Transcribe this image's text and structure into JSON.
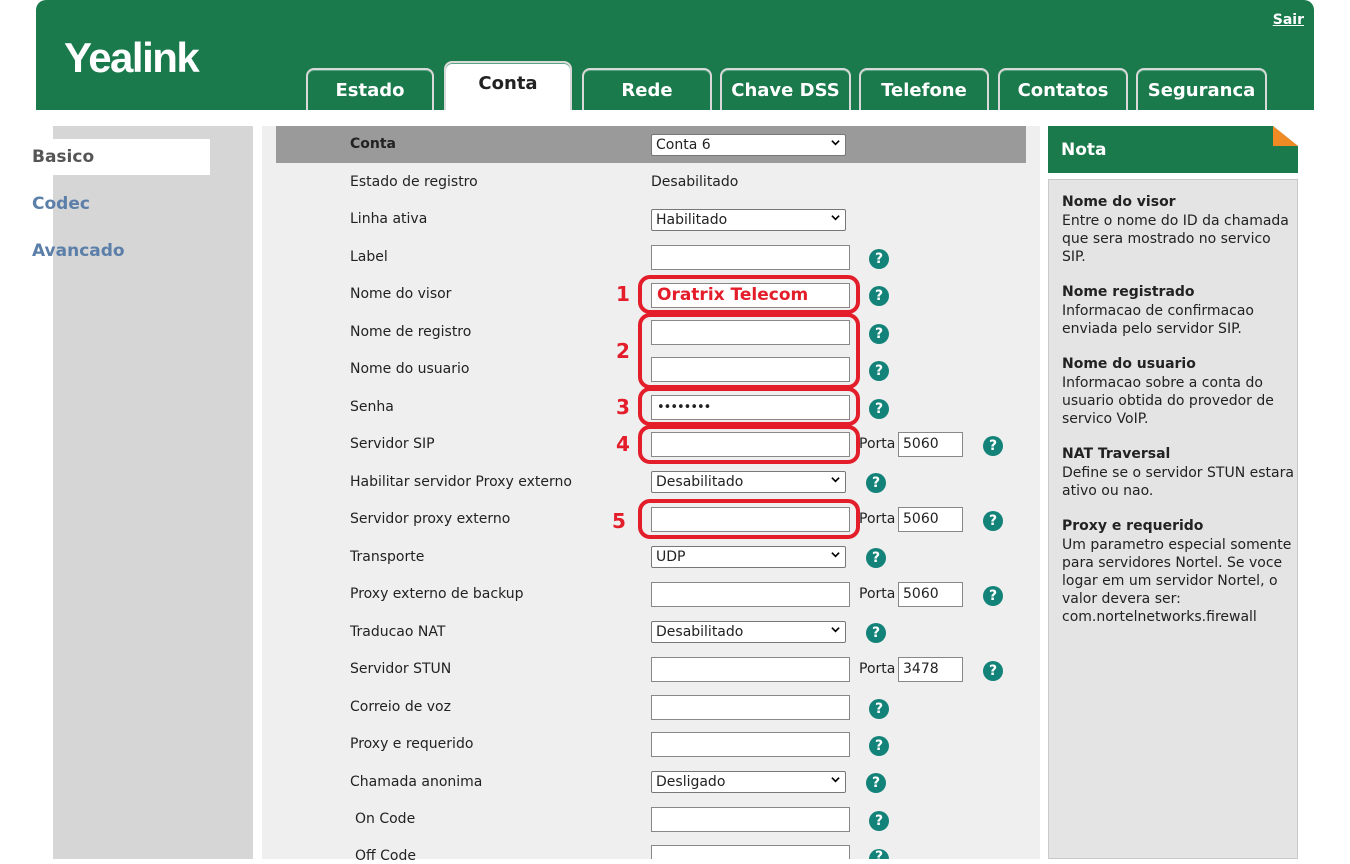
{
  "header": {
    "brand": "Yealink",
    "logout": "Sair",
    "tabs": [
      "Estado",
      "Conta",
      "Rede",
      "Chave DSS",
      "Telefone",
      "Contatos",
      "Seguranca"
    ],
    "active_tab": "Conta"
  },
  "sidebar": {
    "items": [
      "Basico",
      "Codec",
      "Avancado"
    ],
    "active": "Basico"
  },
  "form": {
    "header_label": "Conta",
    "account_select": "Conta 6",
    "porta_label": "Porta",
    "rows": {
      "estado_registro": {
        "label": "Estado de registro",
        "value": "Desabilitado"
      },
      "linha_ativa": {
        "label": "Linha ativa",
        "value": "Habilitado"
      },
      "label": {
        "label": "Label",
        "value": ""
      },
      "nome_visor": {
        "label": "Nome do visor",
        "value": "Oratrix Telecom"
      },
      "nome_registro": {
        "label": "Nome de registro",
        "value": ""
      },
      "nome_usuario": {
        "label": "Nome do usuario",
        "value": ""
      },
      "senha": {
        "label": "Senha",
        "value": "••••••••"
      },
      "servidor_sip": {
        "label": "Servidor SIP",
        "value": "",
        "porta": "5060"
      },
      "habilitar_proxy": {
        "label": "Habilitar servidor Proxy externo",
        "value": "Desabilitado"
      },
      "servidor_proxy": {
        "label": "Servidor proxy externo",
        "value": "",
        "porta": "5060"
      },
      "transporte": {
        "label": "Transporte",
        "value": "UDP"
      },
      "proxy_backup": {
        "label": "Proxy externo de backup",
        "value": "",
        "porta": "5060"
      },
      "traducao_nat": {
        "label": "Traducao NAT",
        "value": "Desabilitado"
      },
      "servidor_stun": {
        "label": "Servidor STUN",
        "value": "",
        "porta": "3478"
      },
      "correio_voz": {
        "label": "Correio de voz",
        "value": ""
      },
      "proxy_requerido": {
        "label": "Proxy e requerido",
        "value": ""
      },
      "chamada_anonima": {
        "label": "Chamada anonima",
        "value": "Desligado"
      },
      "on_code": {
        "label": "On Code",
        "value": ""
      },
      "off_code": {
        "label": "Off Code",
        "value": ""
      }
    }
  },
  "annotations": {
    "color": "#e31d2a",
    "numbers": [
      "1",
      "2",
      "3",
      "4",
      "5"
    ]
  },
  "note": {
    "title": "Nota",
    "items": [
      {
        "title": "Nome do visor",
        "text": "Entre o nome do ID da chamada que sera mostrado no servico SIP."
      },
      {
        "title": "Nome registrado",
        "text": "Informacao de confirmacao enviada pelo servidor SIP."
      },
      {
        "title": "Nome do usuario",
        "text": "Informacao sobre a conta do usuario obtida do provedor de servico VoIP."
      },
      {
        "title": "NAT Traversal",
        "text": "Define se o servidor STUN estara ativo ou nao."
      },
      {
        "title": "Proxy e requerido",
        "text": "Um parametro especial somente para servidores Nortel. Se voce logar em um servidor Nortel, o valor devera ser: com.nortelnetworks.firewall"
      }
    ]
  },
  "colors": {
    "brand_green": "#1a7a4c",
    "help_teal": "#13837a",
    "nav_link": "#5b7fa8"
  },
  "icons": {
    "help": "question-icon",
    "dropdown": "chevron-down-icon",
    "note_corner": "folded-corner-icon"
  }
}
